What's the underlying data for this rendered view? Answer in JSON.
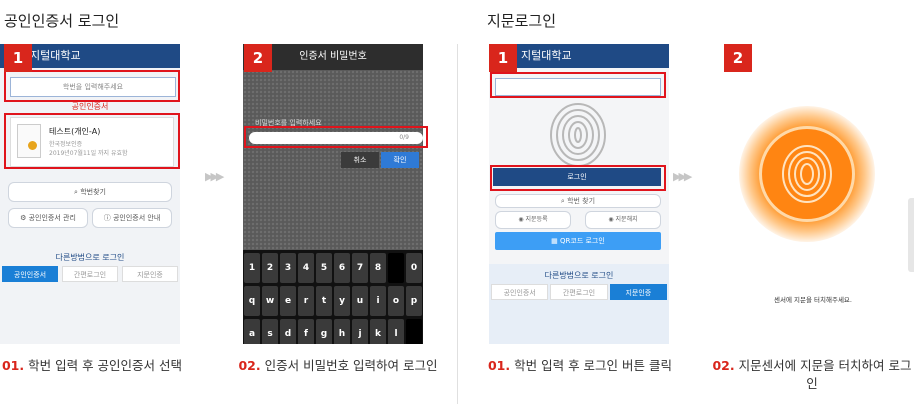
{
  "titles": {
    "cert_login": "공인인증서 로그인",
    "finger_login": "지문로그인"
  },
  "badges": [
    "1",
    "2",
    "1",
    "2"
  ],
  "arrow_glyph": "▶▶▶",
  "panel1": {
    "header": "지털대학교",
    "search_placeholder": "학번을 입력해주세요",
    "cert_section_label": "공인인증서",
    "cert": {
      "name": "테스트(개인-A)",
      "issuer": "한국정보인증",
      "expiry": "2019년07월11일 까지 유효함"
    },
    "find_id": "학번찾기",
    "manage_cert": "공인인증서 관리",
    "cert_guide": "공인인증서 안내",
    "other_methods": "다른방법으로 로그인",
    "tabs": [
      "공인인증서",
      "간편로그인",
      "지문인증"
    ]
  },
  "panel2": {
    "header": "인증서 비밀번호",
    "hint": "비밀번호를 입력하세요",
    "char_count": "0/9",
    "cancel": "취소",
    "confirm": "확인",
    "keys": [
      [
        "1",
        "2",
        "3",
        "4",
        "5",
        "6",
        "7",
        "8",
        "",
        "0"
      ],
      [
        "q",
        "w",
        "e",
        "r",
        "t",
        "y",
        "u",
        "i",
        "o",
        "p"
      ],
      [
        "a",
        "s",
        "d",
        "f",
        "g",
        "h",
        "j",
        "k",
        "l",
        ""
      ]
    ]
  },
  "panel3": {
    "header": "지털대학교",
    "login": "로그인",
    "find_id": "학번 찾기",
    "register_fp": "지문등록",
    "delete_fp": "지문해지",
    "qr_login": "QR코드 로그인",
    "other_methods": "다른방법으로 로그인",
    "tabs": [
      "공인인증서",
      "간편로그인",
      "지문인증"
    ]
  },
  "panel4": {
    "touch_prompt": "센서에 지문을 터치해주세요."
  },
  "captions": [
    {
      "num": "01.",
      "text": "학번 입력 후 공인인증서 선택"
    },
    {
      "num": "02.",
      "text": "인증서 비밀번호 입력하여 로그인"
    },
    {
      "num": "01.",
      "text": "학번 입력 후 로그인 버튼 클릭"
    },
    {
      "num": "02.",
      "text": "지문센서에 지문을 터치하여 로그인"
    }
  ],
  "colors": {
    "accent_red": "#d9261c",
    "header_blue": "#1f4a85",
    "tab_blue": "#1a7fd6",
    "finger_orange": "#ff8512"
  }
}
